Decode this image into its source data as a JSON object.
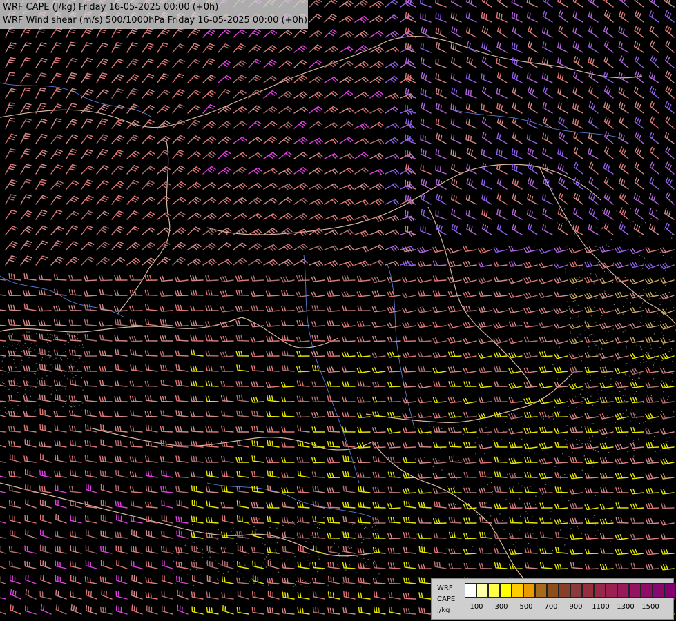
{
  "header": {
    "title_cape": "WRF CAPE (J/kg) Friday 16-05-2025 00:00 (+0h)",
    "title_shear": "WRF Wind shear (m/s) 500/1000hPa Friday 16-05-2025 00:00 (+0h)"
  },
  "legend": {
    "label_model": "WRF",
    "label_field": "CAPE",
    "label_unit": "J/kg",
    "colors": [
      "#ffffff",
      "#ffffaa",
      "#ffff44",
      "#ffff00",
      "#ffcc00",
      "#e89b00",
      "#a66a1a",
      "#8e4d1c",
      "#86402a",
      "#8a3a3c",
      "#923040",
      "#982848",
      "#9a2050",
      "#981a5a",
      "#941462",
      "#8e0c68",
      "#88086e",
      "#800070"
    ],
    "ticks": [
      "100",
      "300",
      "500",
      "700",
      "900",
      "1100",
      "1300",
      "1500"
    ]
  },
  "map": {
    "background": "#000000",
    "border_color": "#d8b8a0",
    "river_color": "#5a7ad8",
    "barb_palette": [
      "#e8e800",
      "#d48a8a",
      "#e07878",
      "#c8a860",
      "#e040e0",
      "#b068d8",
      "#9060e8",
      "#b07070"
    ]
  }
}
